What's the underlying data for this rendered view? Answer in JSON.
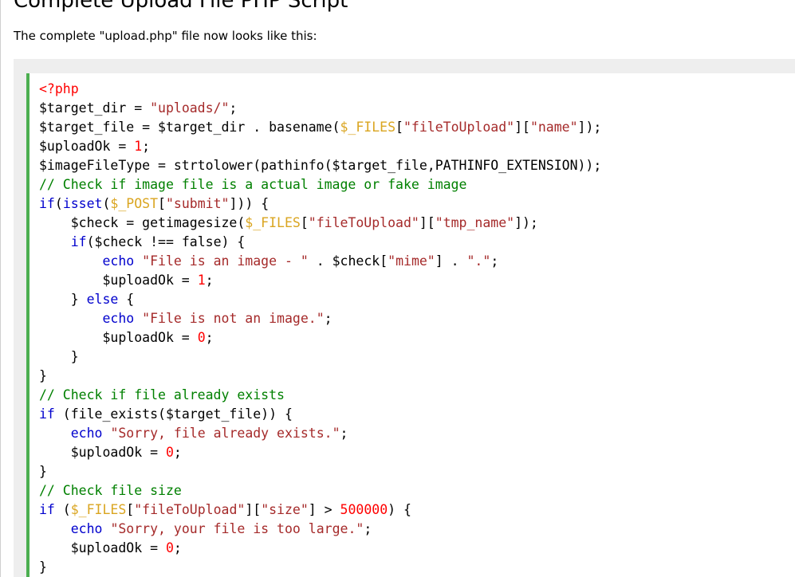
{
  "page": {
    "title": "Complete Upload File PHP Script",
    "intro": "The complete \"upload.php\" file now looks like this:"
  },
  "colors": {
    "accent_border": "#4CAF50",
    "keyword": "mediumblue",
    "string": "brown",
    "superglobal": "#DAA520",
    "number": "red",
    "comment": "green",
    "php_tag": "red",
    "panel_background": "#eeeeee"
  },
  "code": {
    "lines": [
      [
        [
          "tag",
          "<?php"
        ]
      ],
      [
        [
          "plain",
          "$target_dir = "
        ],
        [
          "str",
          "\"uploads/\""
        ],
        [
          "plain",
          ";"
        ]
      ],
      [
        [
          "plain",
          "$target_file = $target_dir . basename("
        ],
        [
          "var",
          "$_FILES"
        ],
        [
          "plain",
          "["
        ],
        [
          "str",
          "\"fileToUpload\""
        ],
        [
          "plain",
          "]["
        ],
        [
          "str",
          "\"name\""
        ],
        [
          "plain",
          "]);"
        ]
      ],
      [
        [
          "plain",
          "$uploadOk = "
        ],
        [
          "num",
          "1"
        ],
        [
          "plain",
          ";"
        ]
      ],
      [
        [
          "plain",
          "$imageFileType = strtolower(pathinfo($target_file,PATHINFO_EXTENSION));"
        ]
      ],
      [
        [
          "com",
          "// Check if image file is a actual image or fake image"
        ]
      ],
      [
        [
          "kw",
          "if"
        ],
        [
          "plain",
          "("
        ],
        [
          "kw",
          "isset"
        ],
        [
          "plain",
          "("
        ],
        [
          "var",
          "$_POST"
        ],
        [
          "plain",
          "["
        ],
        [
          "str",
          "\"submit\""
        ],
        [
          "plain",
          "])) {"
        ]
      ],
      [
        [
          "plain",
          "    $check = getimagesize("
        ],
        [
          "var",
          "$_FILES"
        ],
        [
          "plain",
          "["
        ],
        [
          "str",
          "\"fileToUpload\""
        ],
        [
          "plain",
          "]["
        ],
        [
          "str",
          "\"tmp_name\""
        ],
        [
          "plain",
          "]);"
        ]
      ],
      [
        [
          "plain",
          "    "
        ],
        [
          "kw",
          "if"
        ],
        [
          "plain",
          "($check !== false) {"
        ]
      ],
      [
        [
          "plain",
          "        "
        ],
        [
          "kw",
          "echo"
        ],
        [
          "plain",
          " "
        ],
        [
          "str",
          "\"File is an image - \""
        ],
        [
          "plain",
          " . $check["
        ],
        [
          "str",
          "\"mime\""
        ],
        [
          "plain",
          "] . "
        ],
        [
          "str",
          "\".\""
        ],
        [
          "plain",
          ";"
        ]
      ],
      [
        [
          "plain",
          "        $uploadOk = "
        ],
        [
          "num",
          "1"
        ],
        [
          "plain",
          ";"
        ]
      ],
      [
        [
          "plain",
          "    } "
        ],
        [
          "kw",
          "else"
        ],
        [
          "plain",
          " {"
        ]
      ],
      [
        [
          "plain",
          "        "
        ],
        [
          "kw",
          "echo"
        ],
        [
          "plain",
          " "
        ],
        [
          "str",
          "\"File is not an image.\""
        ],
        [
          "plain",
          ";"
        ]
      ],
      [
        [
          "plain",
          "        $uploadOk = "
        ],
        [
          "num",
          "0"
        ],
        [
          "plain",
          ";"
        ]
      ],
      [
        [
          "plain",
          "    }"
        ]
      ],
      [
        [
          "plain",
          "}"
        ]
      ],
      [
        [
          "com",
          "// Check if file already exists"
        ]
      ],
      [
        [
          "kw",
          "if"
        ],
        [
          "plain",
          " (file_exists($target_file)) {"
        ]
      ],
      [
        [
          "plain",
          "    "
        ],
        [
          "kw",
          "echo"
        ],
        [
          "plain",
          " "
        ],
        [
          "str",
          "\"Sorry, file already exists.\""
        ],
        [
          "plain",
          ";"
        ]
      ],
      [
        [
          "plain",
          "    $uploadOk = "
        ],
        [
          "num",
          "0"
        ],
        [
          "plain",
          ";"
        ]
      ],
      [
        [
          "plain",
          "}"
        ]
      ],
      [
        [
          "com",
          "// Check file size"
        ]
      ],
      [
        [
          "kw",
          "if"
        ],
        [
          "plain",
          " ("
        ],
        [
          "var",
          "$_FILES"
        ],
        [
          "plain",
          "["
        ],
        [
          "str",
          "\"fileToUpload\""
        ],
        [
          "plain",
          "]["
        ],
        [
          "str",
          "\"size\""
        ],
        [
          "plain",
          "] > "
        ],
        [
          "num",
          "500000"
        ],
        [
          "plain",
          ") {"
        ]
      ],
      [
        [
          "plain",
          "    "
        ],
        [
          "kw",
          "echo"
        ],
        [
          "plain",
          " "
        ],
        [
          "str",
          "\"Sorry, your file is too large.\""
        ],
        [
          "plain",
          ";"
        ]
      ],
      [
        [
          "plain",
          "    $uploadOk = "
        ],
        [
          "num",
          "0"
        ],
        [
          "plain",
          ";"
        ]
      ],
      [
        [
          "plain",
          "}"
        ]
      ]
    ]
  }
}
